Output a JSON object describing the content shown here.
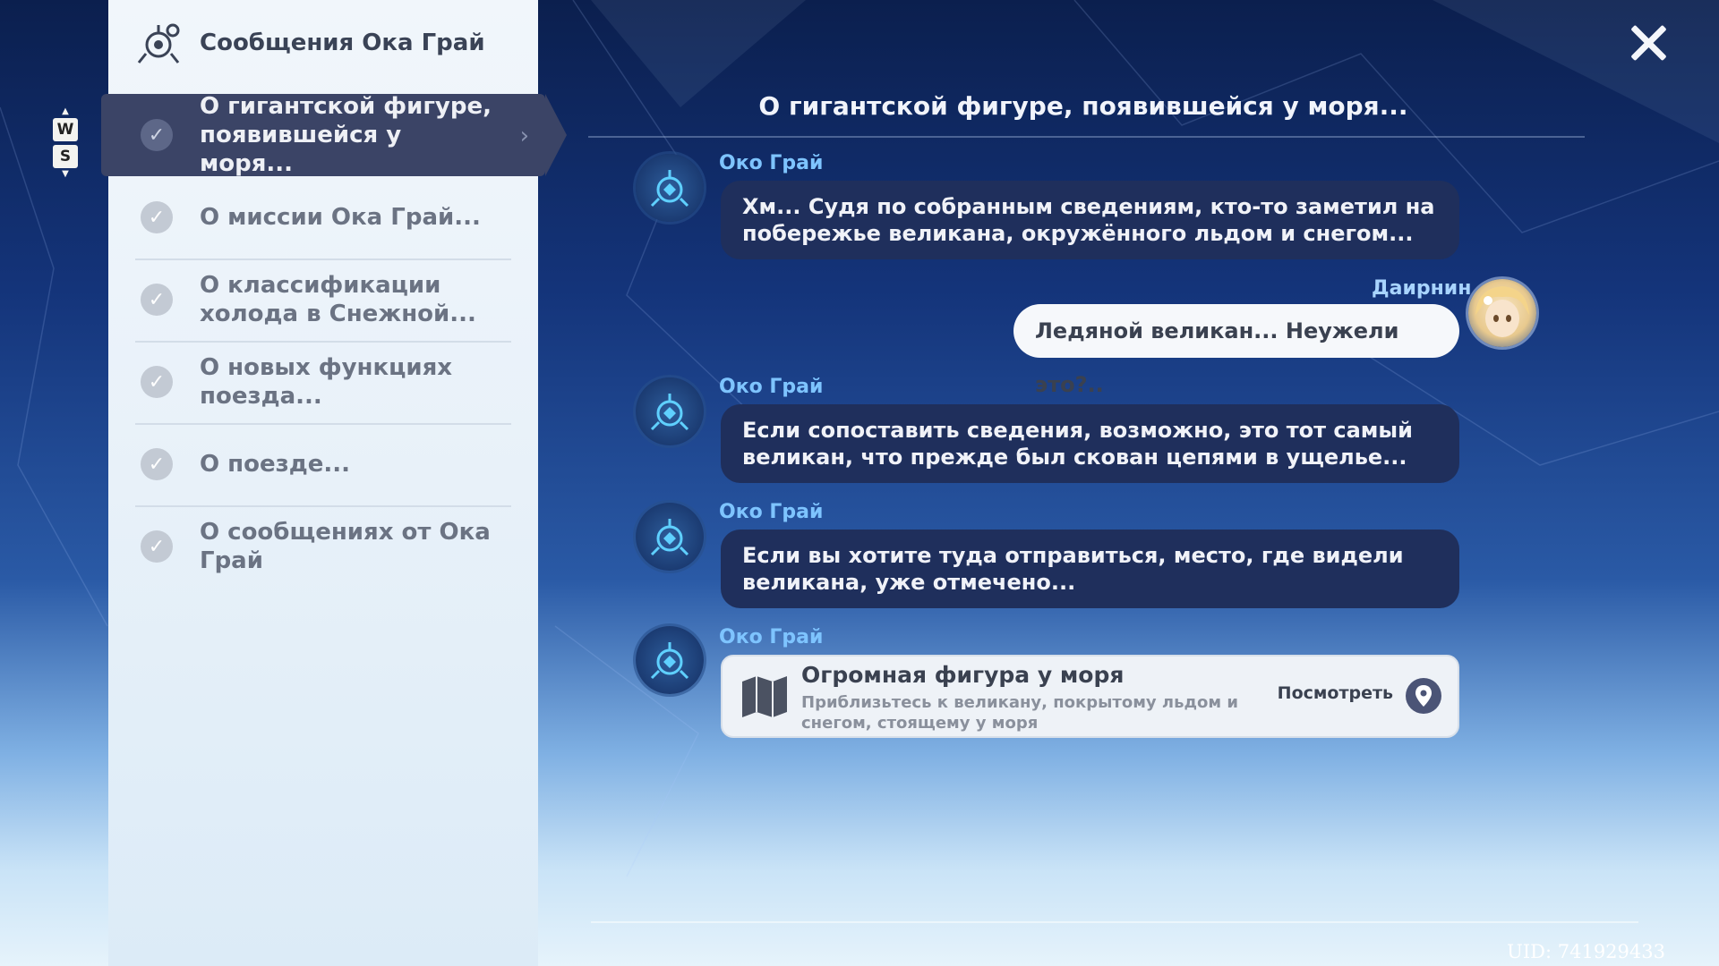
{
  "sidebar": {
    "title": "Сообщения Ока Грай",
    "key_hints": [
      "W",
      "S"
    ],
    "topics": [
      {
        "label": "О гигантской фигуре, появившейся у моря...",
        "selected": true
      },
      {
        "label": "О миссии Ока Грай...",
        "selected": false
      },
      {
        "label": "О классификации холода в Снежной...",
        "selected": false
      },
      {
        "label": "О новых функциях поезда...",
        "selected": false
      },
      {
        "label": "О поезде...",
        "selected": false
      },
      {
        "label": "О сообщениях от Ока Грай",
        "selected": false
      }
    ]
  },
  "conversation": {
    "title": "О гигантской фигуре, появившейся у моря...",
    "messages": [
      {
        "sender": "Око Грай",
        "text": "Хм... Судя по собранным сведениям, кто-то заметил на побережье великана, окружённого льдом и снегом..."
      },
      {
        "sender": "Даирнин",
        "text": "Ледяной великан... Неужели это?.."
      },
      {
        "sender": "Око Грай",
        "text": "Если сопоставить сведения, возможно, это тот самый великан, что прежде был скован цепями в ущелье..."
      },
      {
        "sender": "Око Грай",
        "text": "Если вы хотите туда отправиться, место, где видели великана, уже отмечено..."
      },
      {
        "sender": "Око Грай",
        "card": {
          "title": "Огромная фигура у моря",
          "description": "Приблизьтесь к великану, покрытому льдом и снегом, стоящему у моря",
          "action": "Посмотреть",
          "icon": "map-icon"
        }
      }
    ]
  },
  "uid": "UID: 741929433",
  "colors": {
    "accent_sender": "#7ec4ff",
    "dark_bubble": "#1f2f5c",
    "selected_topic": "#3b4466"
  }
}
